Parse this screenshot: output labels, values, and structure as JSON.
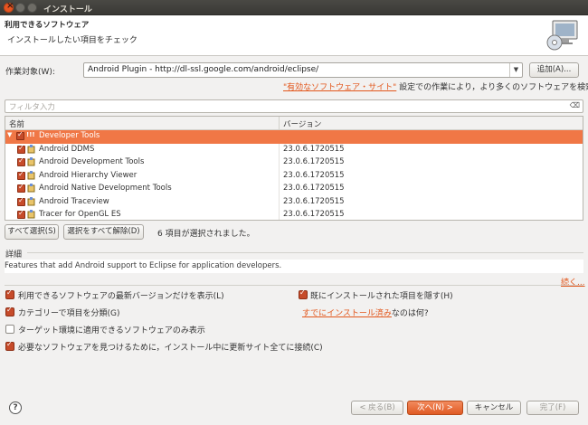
{
  "window": {
    "title": "インストール"
  },
  "header": {
    "title": "利用できるソフトウェア",
    "subtitle": "インストールしたい項目をチェック",
    "icon": "install-monitor-cd-icon"
  },
  "work_with": {
    "label": "作業対象(W):",
    "value": "Android Plugin - http://dl-ssl.google.com/android/eclipse/",
    "add_button": "追加(A)...",
    "hint_link": "\"有効なソフトウェア・サイト\"",
    "hint_text": " 設定での作業により，より多くのソフトウェアを検索。"
  },
  "filter": {
    "placeholder": "フィルタ入力"
  },
  "table": {
    "columns": [
      "名前",
      "バージョン"
    ],
    "group": {
      "label": "Developer Tools",
      "icon_text": "!!!",
      "selected": true,
      "expanded": true
    },
    "rows": [
      {
        "name": "Android DDMS",
        "version": "23.0.6.1720515",
        "checked": true
      },
      {
        "name": "Android Development Tools",
        "version": "23.0.6.1720515",
        "checked": true
      },
      {
        "name": "Android Hierarchy Viewer",
        "version": "23.0.6.1720515",
        "checked": true
      },
      {
        "name": "Android Native Development Tools",
        "version": "23.0.6.1720515",
        "checked": true
      },
      {
        "name": "Android Traceview",
        "version": "23.0.6.1720515",
        "checked": true
      },
      {
        "name": "Tracer for OpenGL ES",
        "version": "23.0.6.1720515",
        "checked": true
      }
    ]
  },
  "selection": {
    "select_all": "すべて選択(S)",
    "deselect_all": "選択をすべて解除(D)",
    "status": "6 項目が選択されました。"
  },
  "details": {
    "label": "詳細",
    "text": "Features that add Android support to Eclipse for application developers.",
    "more_link": "続く..."
  },
  "options": {
    "latest_only": {
      "label": "利用できるソフトウェアの最新バージョンだけを表示(L)",
      "checked": true
    },
    "hide_installed": {
      "label": "既にインストールされた項目を隠す(H)",
      "checked": true
    },
    "group_by_category": {
      "label": "カテゴリーで項目を分類(G)",
      "checked": true
    },
    "already_installed_link": "すでにインストール済み",
    "already_installed_suffix": "なのは何?",
    "target_env_only": {
      "label": "ターゲット環境に適用できるソフトウェアのみ表示",
      "checked": false
    },
    "contact_all_sites": {
      "label": "必要なソフトウェアを見つけるために，インストール中に更新サイト全てに接続(C)",
      "checked": true
    }
  },
  "footer": {
    "help_icon": "help-icon",
    "back": "< 戻る(B)",
    "next": "次へ(N) >",
    "cancel": "キャンセル",
    "finish": "完了(F)"
  },
  "colors": {
    "accent": "#f07746",
    "link": "#e2561b"
  }
}
